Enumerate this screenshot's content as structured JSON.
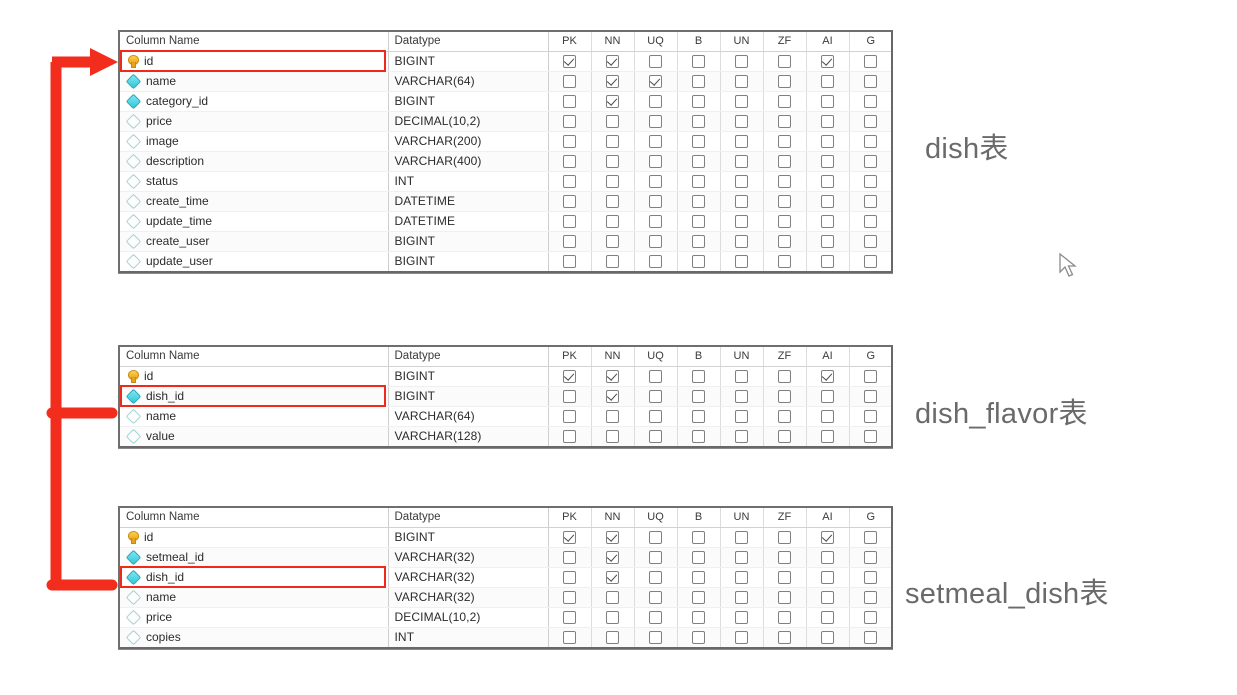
{
  "flag_columns": [
    "PK",
    "NN",
    "UQ",
    "B",
    "UN",
    "ZF",
    "AI",
    "G"
  ],
  "headers": {
    "name": "Column Name",
    "datatype": "Datatype"
  },
  "colors": {
    "highlight_red": "#ef2a1d",
    "arrow_red": "#f22d1e",
    "key_icon_gold": "#e8a11a",
    "diamond_filled_cyan": "#35c6d8",
    "diamond_hollow_teal": "#9fd4d4",
    "caption_gray": "#6a6a6a",
    "table_border_gray": "#686868"
  },
  "tables": [
    {
      "id": "dish",
      "caption": "dish表",
      "rows": [
        {
          "name": "id",
          "datatype": "BIGINT",
          "icon": "key-icon",
          "flags": [
            "PK",
            "NN",
            "AI"
          ],
          "highlighted": true
        },
        {
          "name": "name",
          "datatype": "VARCHAR(64)",
          "icon": "diamond-filled-icon",
          "flags": [
            "NN",
            "UQ"
          ],
          "highlighted": false
        },
        {
          "name": "category_id",
          "datatype": "BIGINT",
          "icon": "diamond-filled-icon",
          "flags": [
            "NN"
          ],
          "highlighted": false
        },
        {
          "name": "price",
          "datatype": "DECIMAL(10,2)",
          "icon": "diamond-hollow-icon",
          "flags": [],
          "highlighted": false
        },
        {
          "name": "image",
          "datatype": "VARCHAR(200)",
          "icon": "diamond-hollow-icon",
          "flags": [],
          "highlighted": false
        },
        {
          "name": "description",
          "datatype": "VARCHAR(400)",
          "icon": "diamond-hollow-icon",
          "flags": [],
          "highlighted": false
        },
        {
          "name": "status",
          "datatype": "INT",
          "icon": "diamond-hollow-icon",
          "flags": [],
          "highlighted": false
        },
        {
          "name": "create_time",
          "datatype": "DATETIME",
          "icon": "diamond-hollow-icon",
          "flags": [],
          "highlighted": false
        },
        {
          "name": "update_time",
          "datatype": "DATETIME",
          "icon": "diamond-hollow-icon",
          "flags": [],
          "highlighted": false
        },
        {
          "name": "create_user",
          "datatype": "BIGINT",
          "icon": "diamond-hollow-icon",
          "flags": [],
          "highlighted": false
        },
        {
          "name": "update_user",
          "datatype": "BIGINT",
          "icon": "diamond-hollow-icon",
          "flags": [],
          "highlighted": false
        }
      ]
    },
    {
      "id": "dish_flavor",
      "caption": "dish_flavor表",
      "rows": [
        {
          "name": "id",
          "datatype": "BIGINT",
          "icon": "key-icon",
          "flags": [
            "PK",
            "NN",
            "AI"
          ],
          "highlighted": false
        },
        {
          "name": "dish_id",
          "datatype": "BIGINT",
          "icon": "diamond-filled-icon",
          "flags": [
            "NN"
          ],
          "highlighted": true
        },
        {
          "name": "name",
          "datatype": "VARCHAR(64)",
          "icon": "diamond-hollow-icon",
          "flags": [],
          "highlighted": false
        },
        {
          "name": "value",
          "datatype": "VARCHAR(128)",
          "icon": "diamond-hollow-icon",
          "flags": [],
          "highlighted": false
        }
      ]
    },
    {
      "id": "setmeal_dish",
      "caption": "setmeal_dish表",
      "rows": [
        {
          "name": "id",
          "datatype": "BIGINT",
          "icon": "key-icon",
          "flags": [
            "PK",
            "NN",
            "AI"
          ],
          "highlighted": false
        },
        {
          "name": "setmeal_id",
          "datatype": "VARCHAR(32)",
          "icon": "diamond-filled-icon",
          "flags": [
            "NN"
          ],
          "highlighted": false
        },
        {
          "name": "dish_id",
          "datatype": "VARCHAR(32)",
          "icon": "diamond-filled-icon",
          "flags": [
            "NN"
          ],
          "highlighted": true
        },
        {
          "name": "name",
          "datatype": "VARCHAR(32)",
          "icon": "diamond-hollow-icon",
          "flags": [],
          "highlighted": false
        },
        {
          "name": "price",
          "datatype": "DECIMAL(10,2)",
          "icon": "diamond-hollow-icon",
          "flags": [],
          "highlighted": false
        },
        {
          "name": "copies",
          "datatype": "INT",
          "icon": "diamond-hollow-icon",
          "flags": [],
          "highlighted": false
        }
      ]
    }
  ],
  "relationship_annotation": {
    "name": "foreign-key-arrow",
    "from": [
      "dish_flavor.dish_id",
      "setmeal_dish.dish_id"
    ],
    "to": "dish.id"
  }
}
